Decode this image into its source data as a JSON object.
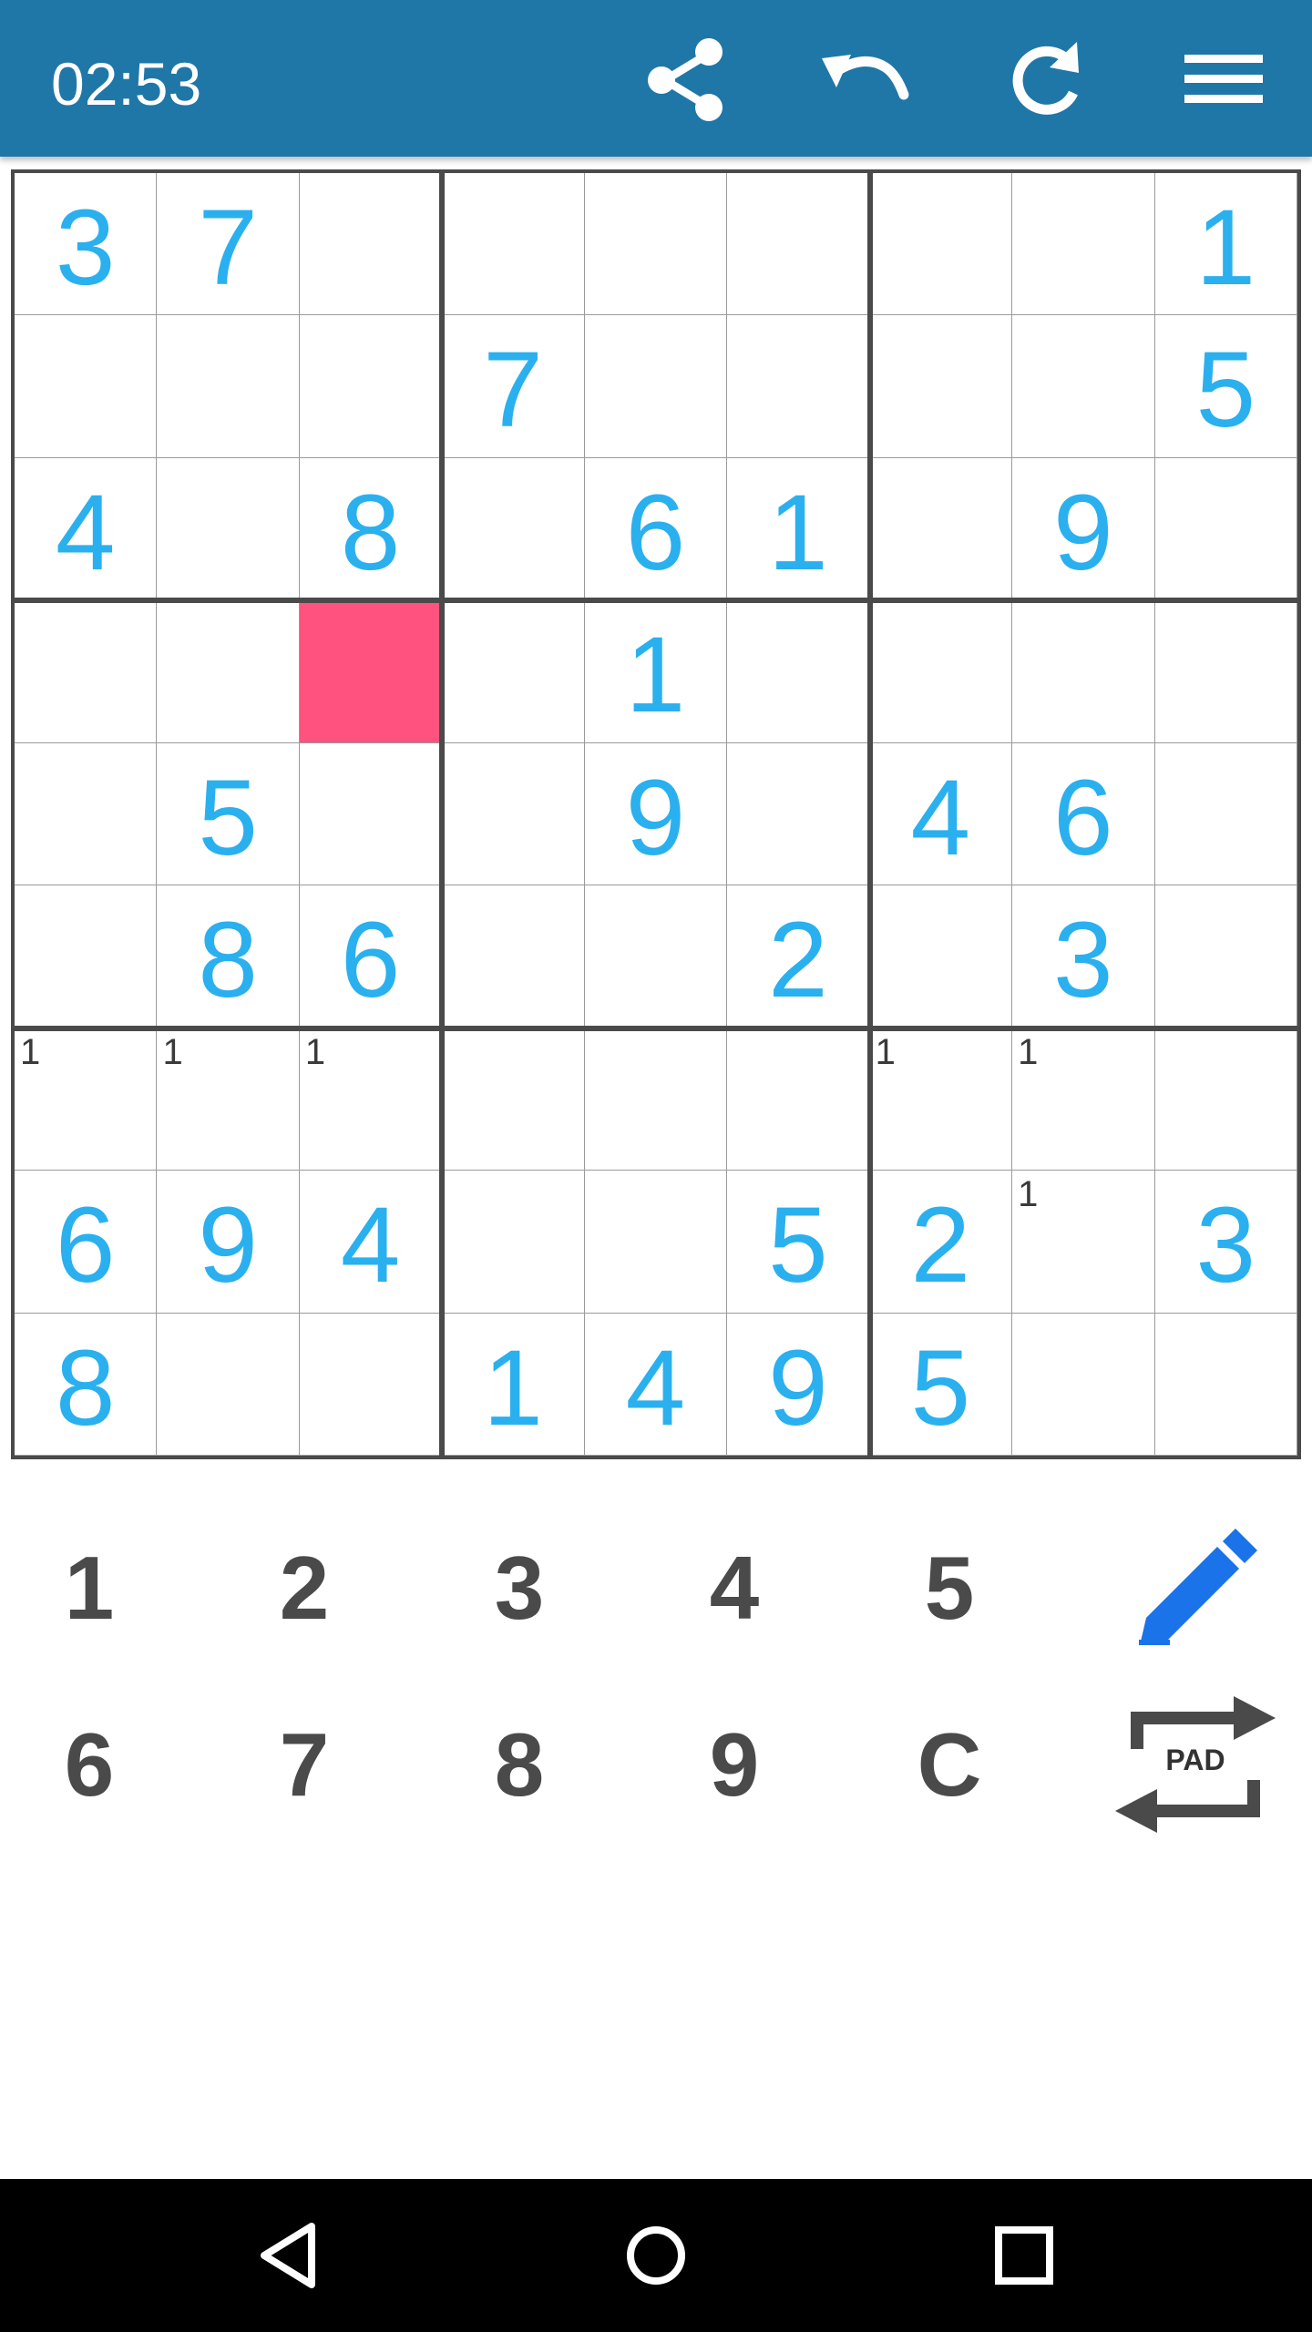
{
  "header": {
    "timer": "02:53",
    "actions": [
      {
        "name": "share-button",
        "icon": "share-icon"
      },
      {
        "name": "undo-button",
        "icon": "undo-icon"
      },
      {
        "name": "redo-button",
        "icon": "redo-icon"
      },
      {
        "name": "menu-button",
        "icon": "hamburger-menu-icon"
      }
    ]
  },
  "board": {
    "digits": [
      [
        "3",
        "7",
        "",
        "",
        "",
        "",
        "",
        "",
        "1"
      ],
      [
        "",
        "",
        "",
        "7",
        "",
        "",
        "",
        "",
        "5"
      ],
      [
        "4",
        "",
        "8",
        "",
        "6",
        "1",
        "",
        "9",
        ""
      ],
      [
        "",
        "",
        "",
        "",
        "1",
        "",
        "",
        "",
        ""
      ],
      [
        "",
        "5",
        "",
        "",
        "9",
        "",
        "4",
        "6",
        ""
      ],
      [
        "",
        "8",
        "6",
        "",
        "",
        "2",
        "",
        "3",
        ""
      ],
      [
        "",
        "",
        "",
        "",
        "",
        "",
        "",
        "",
        ""
      ],
      [
        "6",
        "9",
        "4",
        "",
        "",
        "5",
        "2",
        "",
        "3"
      ],
      [
        "8",
        "",
        "",
        "1",
        "4",
        "9",
        "5",
        "",
        ""
      ]
    ],
    "notes": [
      [
        "",
        "",
        "",
        "",
        "",
        "",
        "",
        "",
        ""
      ],
      [
        "",
        "",
        "",
        "",
        "",
        "",
        "",
        "",
        ""
      ],
      [
        "",
        "",
        "",
        "",
        "",
        "",
        "",
        "",
        ""
      ],
      [
        "",
        "",
        "",
        "",
        "",
        "",
        "",
        "",
        ""
      ],
      [
        "",
        "",
        "",
        "",
        "",
        "",
        "",
        "",
        ""
      ],
      [
        "",
        "",
        "",
        "",
        "",
        "",
        "",
        "",
        ""
      ],
      [
        "1",
        "1",
        "1",
        "",
        "",
        "",
        "1",
        "1",
        ""
      ],
      [
        "",
        "",
        "",
        "",
        "",
        "",
        "",
        "1",
        ""
      ],
      [
        "",
        "",
        "",
        "",
        "",
        "",
        "",
        "",
        ""
      ]
    ],
    "selected_cell": {
      "row": 3,
      "col": 2
    },
    "colors": {
      "given_digit": "#2ab0ee",
      "selected_cell": "#ff527f",
      "note_text": "#3a3a3a",
      "grid_thick": "#4a4a4a",
      "grid_thin": "#9a9a9a"
    }
  },
  "keypad": {
    "row1": [
      "1",
      "2",
      "3",
      "4",
      "5"
    ],
    "row2": [
      "6",
      "7",
      "8",
      "9",
      "C"
    ],
    "pencil_icon": "pencil-icon",
    "pad_toggle_label": "PAD",
    "pad_toggle_icon": "swap-arrows-icon"
  },
  "navbar": {
    "buttons": [
      "back-triangle-icon",
      "home-circle-icon",
      "recents-square-icon"
    ]
  },
  "theme": {
    "header_bg": "#1f77a8",
    "pencil_color": "#1a73e8",
    "keypad_text": "#4a4a4a"
  }
}
